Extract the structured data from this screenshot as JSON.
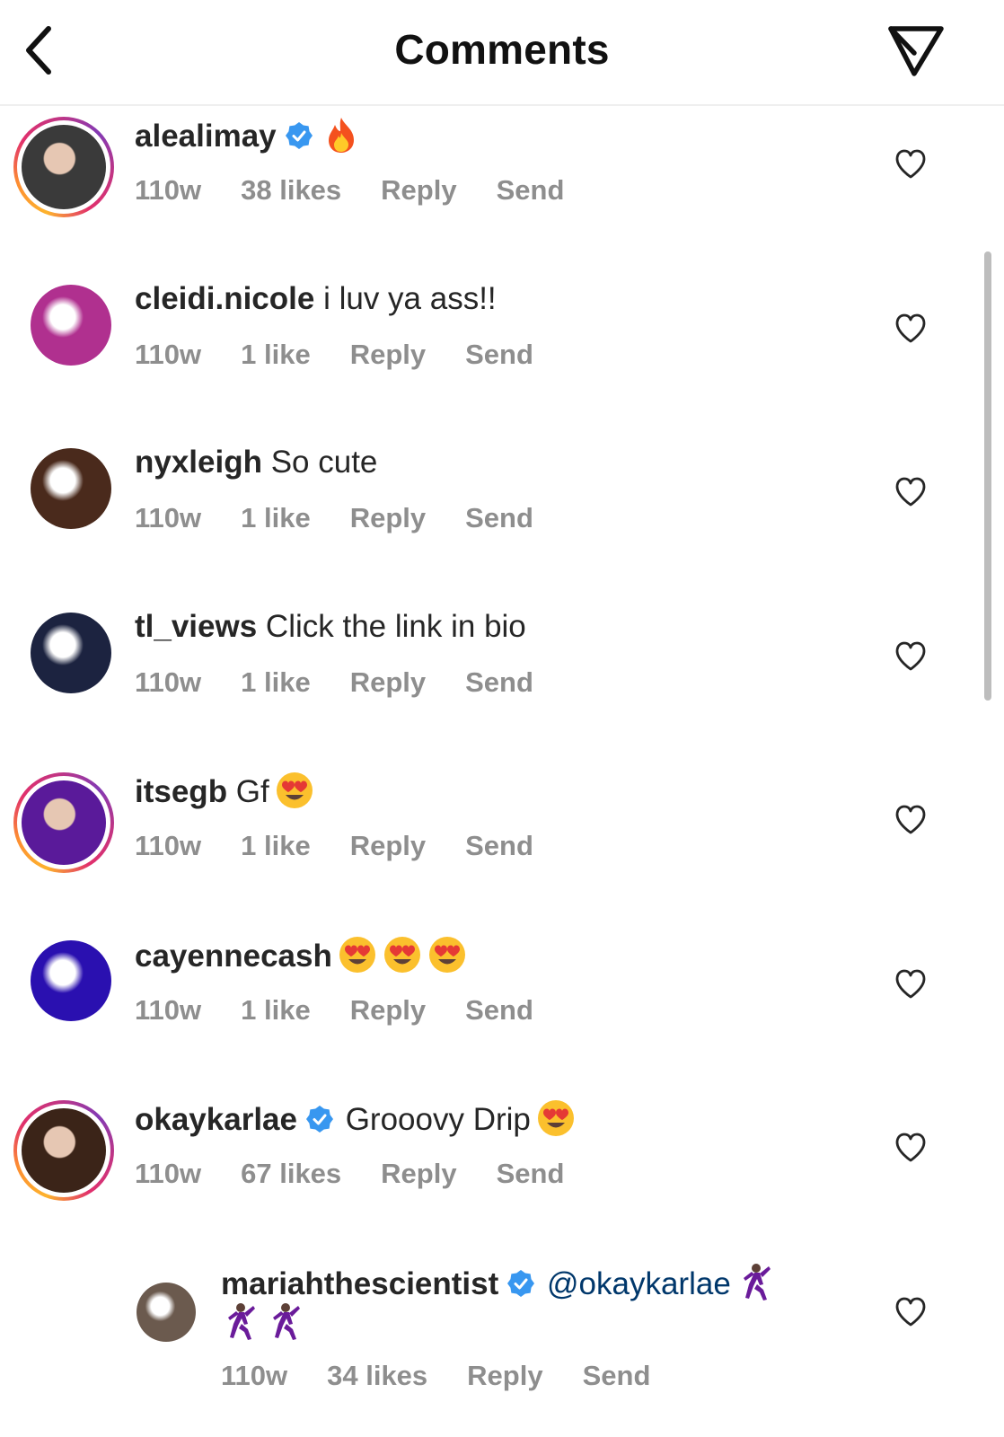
{
  "header": {
    "title": "Comments",
    "back_icon": "chevron-left-icon",
    "share_icon": "paper-plane-icon"
  },
  "comments": [
    {
      "username": "alealimay",
      "verified": true,
      "text": "",
      "emoji": [
        "fire"
      ],
      "age": "110w",
      "likes": "38 likes",
      "reply": "Reply",
      "send": "Send",
      "story_ring": true,
      "avatar_color": "#3a3a3a"
    },
    {
      "username": "cleidi.nicole",
      "verified": false,
      "text": "i luv ya ass!!",
      "emoji": [],
      "age": "110w",
      "likes": "1 like",
      "reply": "Reply",
      "send": "Send",
      "story_ring": false,
      "avatar_color": "#b0308f"
    },
    {
      "username": "nyxleigh",
      "verified": false,
      "text": "So cute",
      "emoji": [],
      "age": "110w",
      "likes": "1 like",
      "reply": "Reply",
      "send": "Send",
      "story_ring": false,
      "avatar_color": "#4a2a1c"
    },
    {
      "username": "tl_views",
      "verified": false,
      "text": "Click the link in bio",
      "emoji": [],
      "age": "110w",
      "likes": "1 like",
      "reply": "Reply",
      "send": "Send",
      "story_ring": false,
      "avatar_color": "#1c2340"
    },
    {
      "username": "itsegb",
      "verified": false,
      "text": "Gf",
      "emoji": [
        "heart-eyes"
      ],
      "age": "110w",
      "likes": "1 like",
      "reply": "Reply",
      "send": "Send",
      "story_ring": true,
      "avatar_color": "#5a1a9a"
    },
    {
      "username": "cayennecash",
      "verified": false,
      "text": "",
      "emoji": [
        "heart-eyes",
        "heart-eyes",
        "heart-eyes"
      ],
      "age": "110w",
      "likes": "1 like",
      "reply": "Reply",
      "send": "Send",
      "story_ring": false,
      "avatar_color": "#2a10b0"
    },
    {
      "username": "okaykarlae",
      "verified": true,
      "text": "Grooovy Drip",
      "emoji": [
        "heart-eyes"
      ],
      "age": "110w",
      "likes": "67 likes",
      "reply": "Reply",
      "send": "Send",
      "story_ring": true,
      "avatar_color": "#3b2418"
    }
  ],
  "reply": {
    "username": "mariahthescientist",
    "verified": true,
    "mention": "@okaykarlae",
    "emoji": [
      "man-dancing",
      "man-dancing",
      "man-dancing"
    ],
    "age": "110w",
    "likes": "34 likes",
    "reply": "Reply",
    "send": "Send",
    "avatar_color": "#6b5a4e"
  },
  "colors": {
    "text": "#262626",
    "meta": "#8e8e8e",
    "verified": "#3897f0",
    "mention": "#00376b"
  }
}
